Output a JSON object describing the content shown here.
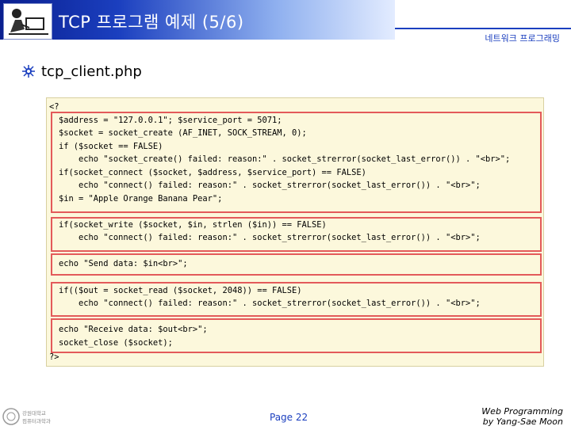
{
  "header": {
    "title": "TCP 프로그램 예제 (5/6)",
    "nav_label": "네트워크 프로그래밍"
  },
  "slide": {
    "subtitle": "tcp_client.php",
    "code_lines": [
      "<?",
      "$address = \"127.0.0.1\"; $service_port = 5071;",
      "$socket = socket_create (AF_INET, SOCK_STREAM, 0);",
      "if ($socket == FALSE)",
      "    echo \"socket_create() failed: reason:\" . socket_strerror(socket_last_error()) . \"<br>\";",
      "if(socket_connect ($socket, $address, $service_port) == FALSE)",
      "    echo \"connect() failed: reason:\" . socket_strerror(socket_last_error()) . \"<br>\";",
      "$in = \"Apple Orange Banana Pear\";",
      "if(socket_write ($socket, $in, strlen ($in)) == FALSE)",
      "    echo \"connect() failed: reason:\" . socket_strerror(socket_last_error()) . \"<br>\";",
      "echo \"Send data: $in<br>\";",
      "if(($out = socket_read ($socket, 2048)) == FALSE)",
      "    echo \"connect() failed: reason:\" . socket_strerror(socket_last_error()) . \"<br>\";",
      "echo \"Receive data: $out<br>\";",
      "socket_close ($socket);",
      "?>"
    ]
  },
  "footer": {
    "page": "Page 22",
    "credit_line1": "Web Programming",
    "credit_line2": "by Yang-Sae Moon",
    "logo_text": "강원대학교 컴퓨터과학과"
  },
  "colors": {
    "title_gradient_start": "#0a1f8f",
    "accent": "#1b3fbf",
    "code_background": "#fcf8dc",
    "code_box_border": "#e35a5a"
  },
  "icons": {
    "title_icon": "person-at-computer-icon",
    "bullet_icon": "gear-bullet-icon",
    "footer_logo": "university-logo"
  }
}
